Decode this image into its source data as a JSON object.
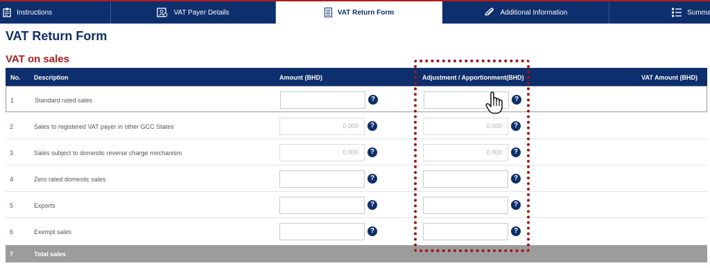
{
  "tabs": [
    {
      "label": "Instructions",
      "icon": "clipboard-icon"
    },
    {
      "label": "VAT Payer Details",
      "icon": "id-card-icon"
    },
    {
      "label": "VAT Return Form",
      "icon": "list-icon",
      "active": true
    },
    {
      "label": "Additional Information",
      "icon": "paperclip-icon"
    },
    {
      "label": "Summa",
      "icon": "bulleted-list-icon"
    }
  ],
  "page": {
    "title": "VAT Return Form",
    "section_title": "VAT on sales"
  },
  "table": {
    "headers": {
      "no": "No.",
      "description": "Description",
      "amount": "Amount (BHD)",
      "adjustment": "Adjustment / Apportionment(BHD)",
      "vat_amount": "VAT Amount (BHD)"
    },
    "help_glyph": "?",
    "rows": [
      {
        "no": "1",
        "description": "Standard rated sales",
        "amount": "",
        "adjustment": ""
      },
      {
        "no": "2",
        "description": "Sales to registered VAT payer in other GCC States",
        "amount": "0.000",
        "adjustment": "0.000"
      },
      {
        "no": "3",
        "description": "Sales subject to domestic reverse charge mechanism",
        "amount": "0.000",
        "adjustment": "0.000"
      },
      {
        "no": "4",
        "description": "Zero rated domestic sales",
        "amount": "",
        "adjustment": ""
      },
      {
        "no": "5",
        "description": "Exports",
        "amount": "",
        "adjustment": ""
      },
      {
        "no": "6",
        "description": "Exempt sales",
        "amount": "",
        "adjustment": ""
      }
    ],
    "total": {
      "no": "7",
      "description": "Total sales"
    }
  },
  "colors": {
    "navy": "#0e2f6e",
    "accent_red": "#b31b1b",
    "highlight_dots": "#a31212",
    "total_row": "#9c9c9c"
  }
}
